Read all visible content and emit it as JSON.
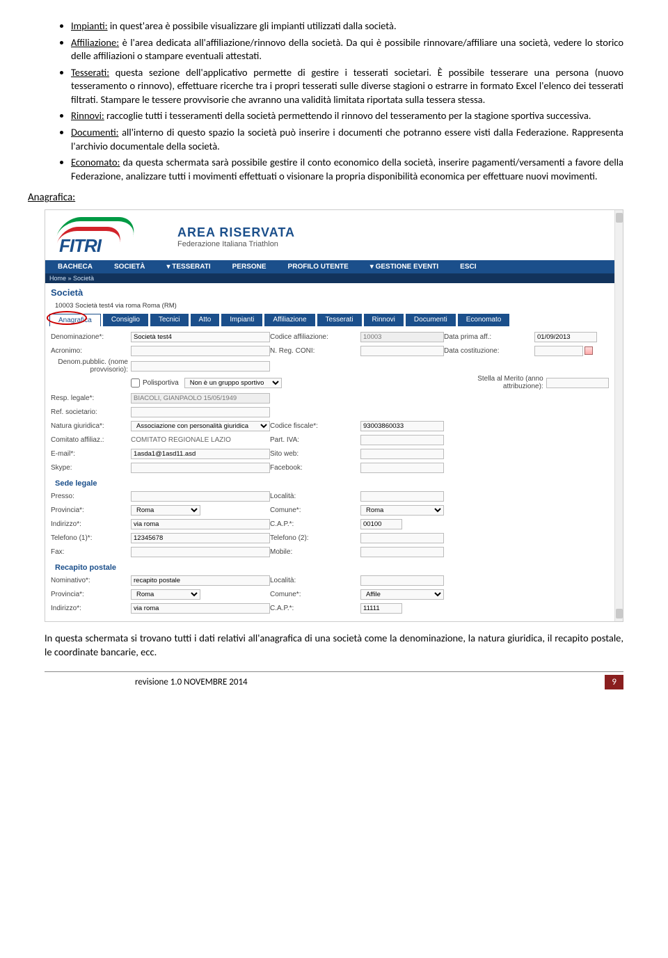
{
  "bullets": [
    {
      "term": "Impianti:",
      "text": " in quest'area è possibile visualizzare gli impianti utilizzati dalla società."
    },
    {
      "term": "Affiliazione:",
      "text": " è l'area dedicata all'affiliazione/rinnovo della società. Da qui è possibile rinnovare/affiliare una società, vedere lo storico delle affiliazioni o stampare eventuali attestati."
    },
    {
      "term": "Tesserati:",
      "text": " questa sezione dell'applicativo permette di gestire i tesserati societari. È possibile tesserare una persona (nuovo tesseramento o rinnovo), effettuare ricerche tra i propri tesserati sulle diverse stagioni o estrarre in formato Excel l'elenco dei tesserati filtrati. Stampare le tessere provvisorie che avranno una validità limitata riportata sulla tessera stessa."
    },
    {
      "term": "Rinnovi:",
      "text": " raccoglie tutti i tesseramenti della società permettendo il rinnovo del tesseramento per la stagione sportiva successiva."
    },
    {
      "term": "Documenti:",
      "text": " all'interno di questo spazio la società può inserire i documenti che potranno essere visti dalla Federazione. Rappresenta l'archivio documentale della società."
    },
    {
      "term": "Economato:",
      "text": " da questa schermata sarà possibile gestire il conto economico della società, inserire pagamenti/versamenti a favore della Federazione, analizzare tutti i movimenti effettuati o visionare la propria disponibilità economica per effettuare nuovi movimenti."
    }
  ],
  "section_title": "Anagrafica:",
  "logo": {
    "text": "FITRI",
    "area_title": "AREA RISERVATA",
    "area_sub": "Federazione Italiana Triathlon"
  },
  "topnav": [
    "BACHECA",
    "SOCIETÀ",
    "▾ TESSERATI",
    "PERSONE",
    "PROFILO UTENTE",
    "▾ GESTIONE EVENTI",
    "ESCI"
  ],
  "breadcrumb": "Home » Società",
  "page_title": "Società",
  "society_line": "10003 Società test4 via roma Roma (RM)",
  "subnav": [
    "Anagrafica",
    "Consiglio",
    "Tecnici",
    "Atto",
    "Impianti",
    "Affiliazione",
    "Tesserati",
    "Rinnovi",
    "Documenti",
    "Economato"
  ],
  "labels": {
    "denom": "Denominazione*:",
    "cod_aff": "Codice affiliazione:",
    "data_prima": "Data prima aff.:",
    "acronimo": "Acronimo:",
    "nreg": "N. Reg. CONI:",
    "data_cost": "Data costituzione:",
    "denom_pub": "Denom.pubblic. (nome provvisorio):",
    "polisportiva": "Polisportiva",
    "stella": "Stella al Merito (anno attribuzione):",
    "resp": "Resp. legale*:",
    "ref": "Ref. societario:",
    "natura": "Natura giuridica*:",
    "cf": "Codice fiscale*:",
    "comitato": "Comitato affiliaz.:",
    "piva": "Part. IVA:",
    "email": "E-mail*:",
    "sito": "Sito web:",
    "skype": "Skype:",
    "facebook": "Facebook:",
    "sede_hdr": "Sede legale",
    "presso": "Presso:",
    "localita": "Località:",
    "provincia": "Provincia*:",
    "comune": "Comune*:",
    "indirizzo": "Indirizzo*:",
    "cap": "C.A.P.*:",
    "tel1": "Telefono (1)*:",
    "tel2": "Telefono (2):",
    "fax": "Fax:",
    "mobile": "Mobile:",
    "rec_hdr": "Recapito postale",
    "nominativo": "Nominativo*:"
  },
  "values": {
    "denom": "Società test4",
    "cod_aff": "10003",
    "data_prima": "01/09/2013",
    "gruppo_sportivo": "Non è un gruppo sportivo",
    "resp": "BIACOLI, GIANPAOLO 15/05/1949",
    "natura": "Associazione con personalità giuridica",
    "cf": "93003860033",
    "comitato": "COMITATO REGIONALE LAZIO",
    "email": "1asda1@1asd11.asd",
    "provincia": "Roma",
    "comune": "Roma",
    "indirizzo": "via roma",
    "cap": "00100",
    "tel1": "12345678",
    "nominativo": "recapito postale",
    "provincia2": "Roma",
    "comune2": "Affile",
    "indirizzo2": "via roma",
    "cap2": "11111"
  },
  "after_text": "In questa schermata si trovano tutti i dati relativi all'anagrafica di una società come la denominazione, la natura giuridica, il recapito postale, le coordinate bancarie, ecc.",
  "footer": {
    "revision": "revisione  1.0  NOVEMBRE 2014",
    "page": "9"
  }
}
